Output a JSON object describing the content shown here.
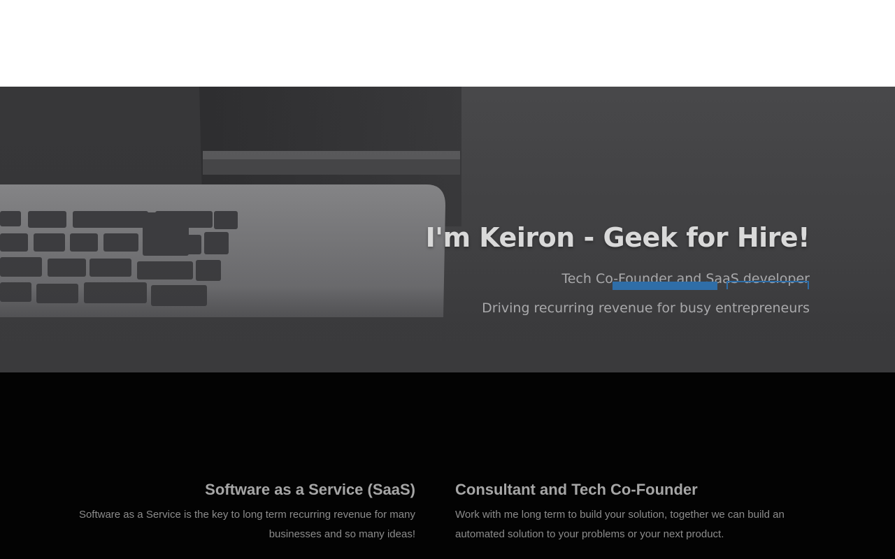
{
  "hero": {
    "title": "I'm Keiron - Geek for Hire!",
    "subtitle_1": "Tech Co-Founder and SaaS developer",
    "subtitle_2": "Driving recurring revenue for busy entrepreneurs"
  },
  "services": [
    {
      "title": "Software as a Service (SaaS)",
      "description": "Software as a Service is the key to long term recurring revenue for many businesses and so many ideas!"
    },
    {
      "title": "Consultant and Tech Co-Founder",
      "description": "Work with me long term to build your solution, together we can build an automated solution to your problems or your next product."
    }
  ],
  "colors": {
    "accent": "#2f6ea8",
    "services_background": "#030303",
    "hero_title": "#d9d9d9"
  }
}
